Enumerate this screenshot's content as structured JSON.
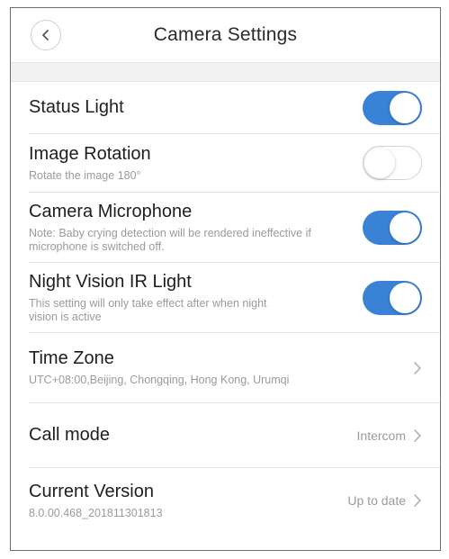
{
  "header": {
    "title": "Camera Settings",
    "back_icon": "chevron-left-icon"
  },
  "colors": {
    "toggle_on": "#3a82d6",
    "section_gap": "#f2f2f4"
  },
  "settings": {
    "status_light": {
      "label": "Status Light",
      "enabled": true
    },
    "image_rotation": {
      "label": "Image Rotation",
      "sub": "Rotate the image 180°",
      "enabled": false
    },
    "camera_microphone": {
      "label": "Camera Microphone",
      "sub": "Note: Baby crying detection will be rendered ineffective if microphone is switched off.",
      "enabled": true
    },
    "night_vision": {
      "label": "Night Vision IR Light",
      "sub": "This setting will only take effect after when night vision is active",
      "enabled": true
    },
    "time_zone": {
      "label": "Time Zone",
      "sub": "UTC+08:00,Beijing, Chongqing, Hong Kong, Urumqi"
    },
    "call_mode": {
      "label": "Call mode",
      "value": "Intercom"
    },
    "current_version": {
      "label": "Current Version",
      "sub": "8.0.00.468_201811301813",
      "value": "Up to date"
    }
  }
}
